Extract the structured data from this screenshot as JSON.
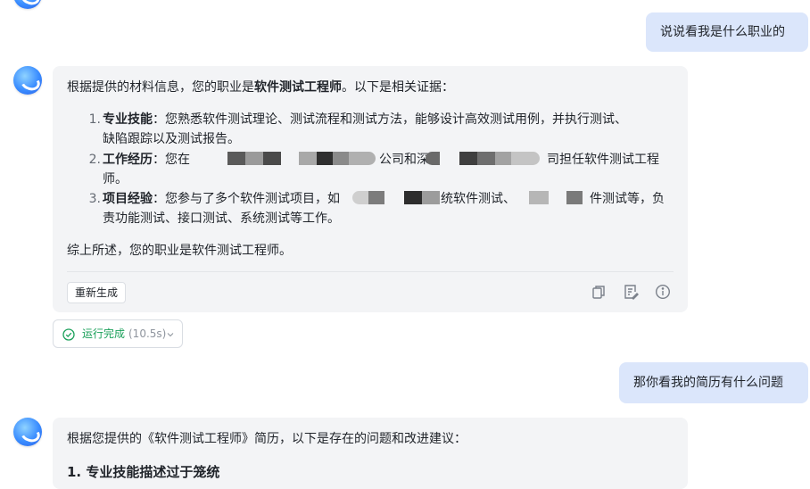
{
  "colors": {
    "user_bubble": "#dbe6fb",
    "ai_bubble": "#f3f4f6",
    "status_green": "#1aa05a",
    "mask_dark": "#3a3a3a",
    "mask_mid": "#6e6e6e",
    "mask_light": "#b4b4b4"
  },
  "conversation": {
    "q1": "说说看我是什么职业的",
    "a1": {
      "intro_prefix": "根据提供的材料信息，您的职业是",
      "intro_bold": "软件测试工程师",
      "intro_suffix": "。以下是相关证据：",
      "items": [
        {
          "num": "1.",
          "title": "专业技能",
          "line1": "：您熟悉软件测试理论、测试流程和测试方法，能够设计高效测试用例，并执行测试、",
          "line2": "缺陷跟踪以及测试报告。"
        },
        {
          "num": "2.",
          "title": "工作经历",
          "line1_a": "：您在",
          "line1_b": "公司和深",
          "line1_c": "司担任软件测试工程",
          "line2": "师。"
        },
        {
          "num": "3.",
          "title": "项目经验",
          "line1_a": "：您参与了多个软件测试项目，如",
          "line1_b": "统软件测试、",
          "line1_c": "件测试等，负",
          "line2": "责功能测试、接口测试、系统测试等工作。"
        }
      ],
      "conclusion": "综上所述，您的职业是软件测试工程师。",
      "regenerate_label": "重新生成",
      "icons": [
        "copy-icon",
        "edit-note-icon",
        "info-icon"
      ]
    },
    "status": {
      "label": "运行完成",
      "time": "(10.5s)",
      "icon": "check-circle-icon",
      "chevron": "chevron-down-icon"
    },
    "q2": "那你看我的简历有什么问题",
    "a2": {
      "intro": "根据您提供的《软件测试工程师》简历，以下是存在的问题和改进建议：",
      "heading": "1. 专业技能描述过于笼统"
    }
  }
}
